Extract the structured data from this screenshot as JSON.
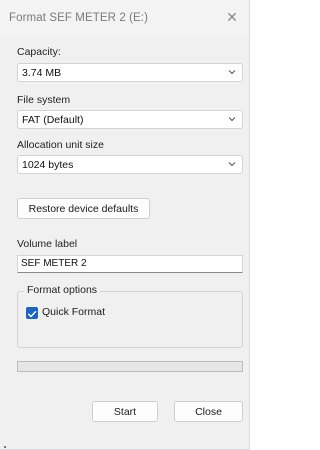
{
  "window": {
    "title": "Format SEF METER 2 (E:)",
    "close_glyph": "✕"
  },
  "capacity": {
    "label": "Capacity:",
    "value": "3.74 MB"
  },
  "file_system": {
    "label": "File system",
    "value": "FAT (Default)"
  },
  "allocation": {
    "label": "Allocation unit size",
    "value": "1024 bytes"
  },
  "restore_button": "Restore device defaults",
  "volume": {
    "label": "Volume label",
    "value": "SEF METER 2"
  },
  "format_options": {
    "label": "Format options",
    "quick_format_label": "Quick Format",
    "quick_format_checked": true
  },
  "progress": {
    "value": 0
  },
  "buttons": {
    "start": "Start",
    "close": "Close"
  },
  "colors": {
    "accent": "#1a66c4",
    "progress_fill": "#06b025"
  },
  "icons": {
    "close": "close-icon",
    "chevron": "chevron-down-icon",
    "check": "checkmark-icon"
  }
}
